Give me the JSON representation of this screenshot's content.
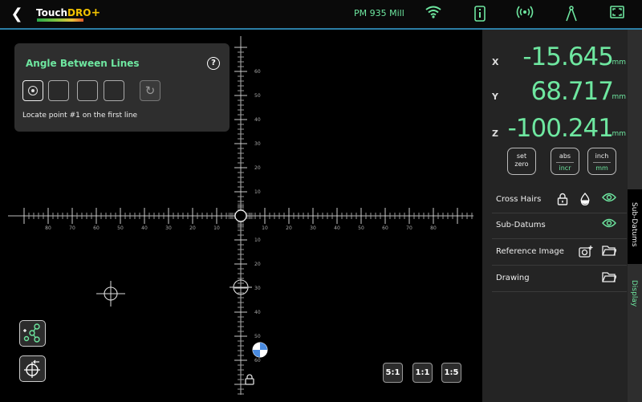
{
  "header": {
    "logo_touch": "Touch",
    "logo_dro": "DRO",
    "logo_plus": "+",
    "machine_name": "PM 935 Mill",
    "icons": [
      "back-arrow-icon",
      "wifi-icon",
      "info-icon",
      "broadcast-icon",
      "compass-icon",
      "fullscreen-icon"
    ]
  },
  "tool": {
    "title": "Angle Between Lines",
    "message": "Locate point #1 on the first line",
    "steps": 4,
    "active_step": 1
  },
  "scale": {
    "x_ticks_left": [
      "80",
      "70",
      "60",
      "50",
      "40",
      "30",
      "20",
      "10"
    ],
    "x_ticks_right": [
      "10",
      "20",
      "30",
      "40",
      "50",
      "60",
      "70",
      "80"
    ],
    "y_ticks_up": [
      "60",
      "50",
      "40",
      "30",
      "20",
      "10"
    ],
    "y_ticks_down": [
      "10",
      "20",
      "30",
      "40",
      "50",
      "60"
    ]
  },
  "zoom": [
    "5:1",
    "1:1",
    "1:5"
  ],
  "readout": {
    "x": {
      "label": "X",
      "value": "-15.645",
      "unit": "mm"
    },
    "y": {
      "label": "Y",
      "value": "68.717",
      "unit": "mm"
    },
    "z": {
      "label": "Z",
      "value": "-100.241",
      "unit": "mm"
    }
  },
  "buttons": {
    "set_top": "set",
    "set_bottom": "zero",
    "abs": "abs",
    "incr": "incr",
    "inch": "inch",
    "mm": "mm"
  },
  "display_list": [
    {
      "label": "Cross Hairs"
    },
    {
      "label": "Sub-Datums"
    },
    {
      "label": "Reference Image"
    },
    {
      "label": "Drawing"
    }
  ],
  "tabs": {
    "sub_datums": "Sub-Datums",
    "display": "Display"
  },
  "colors": {
    "accent": "#6ee7a0",
    "divider": "#2c7fa6",
    "panel": "#242424"
  }
}
